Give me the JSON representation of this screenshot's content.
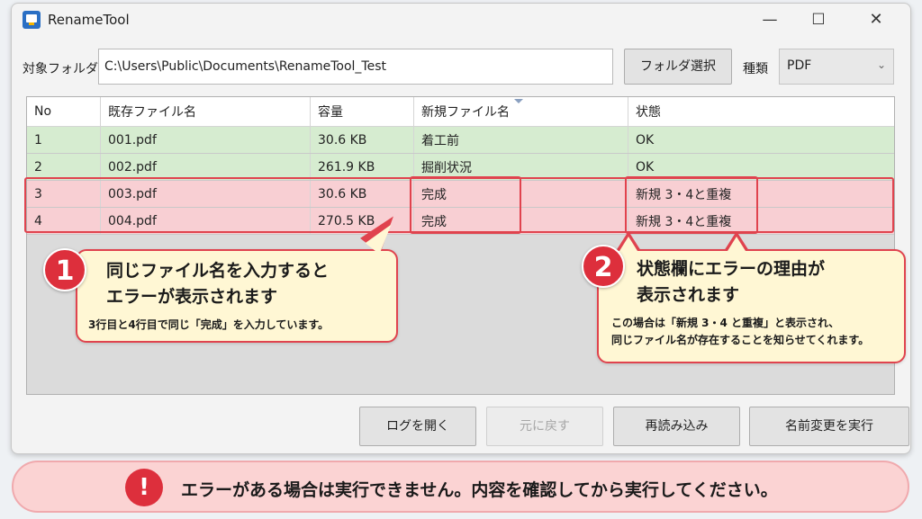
{
  "window": {
    "title": "RenameTool",
    "controls": {
      "minimize": "—",
      "maximize": "☐",
      "close": "✕"
    }
  },
  "toolbar": {
    "folder_label": "対象フォルダ",
    "folder_value": "C:\\Users\\Public\\Documents\\RenameTool_Test",
    "folder_button": "フォルダ選択",
    "type_label": "種類",
    "type_value": "PDF",
    "type_chevron": "⌄"
  },
  "table": {
    "columns": [
      "No",
      "既存ファイル名",
      "容量",
      "新規ファイル名",
      "状態"
    ],
    "rows": [
      {
        "no": "1",
        "name": "001.pdf",
        "size": "30.6 KB",
        "new_name": "着工前",
        "status": "OK",
        "state": "ok"
      },
      {
        "no": "2",
        "name": "002.pdf",
        "size": "261.9 KB",
        "new_name": "掘削状況",
        "status": "OK",
        "state": "ok"
      },
      {
        "no": "3",
        "name": "003.pdf",
        "size": "30.6 KB",
        "new_name": "完成",
        "status": "新規 3・4と重複",
        "state": "error"
      },
      {
        "no": "4",
        "name": "004.pdf",
        "size": "270.5 KB",
        "new_name": "完成",
        "status": "新規 3・4と重複",
        "state": "error"
      }
    ]
  },
  "callouts": [
    {
      "number": "1",
      "title_line1": "同じファイル名を入力すると",
      "title_line2": "エラーが表示されます",
      "desc_line1": "3行目と4行目で同じ「完成」を入力しています。"
    },
    {
      "number": "2",
      "title_line1": "状態欄にエラーの理由が",
      "title_line2": "表示されます",
      "desc_line1": "この場合は「新規 3・4 と重複」と表示され、",
      "desc_line2": "同じファイル名が存在することを知らせてくれます。"
    }
  ],
  "buttons": {
    "open_log": "ログを開く",
    "undo": "元に戻す",
    "reload": "再読み込み",
    "execute": "名前変更を実行"
  },
  "banner": {
    "icon": "!",
    "text": "エラーがある場合は実行できません。内容を確認してから実行してください。"
  },
  "colors": {
    "ok_row": "#d6ecd0",
    "error_row": "#f8cfd3",
    "highlight": "#e0434e",
    "callout_bg": "#fff7d4",
    "banner_bg": "#fbd3d3"
  }
}
